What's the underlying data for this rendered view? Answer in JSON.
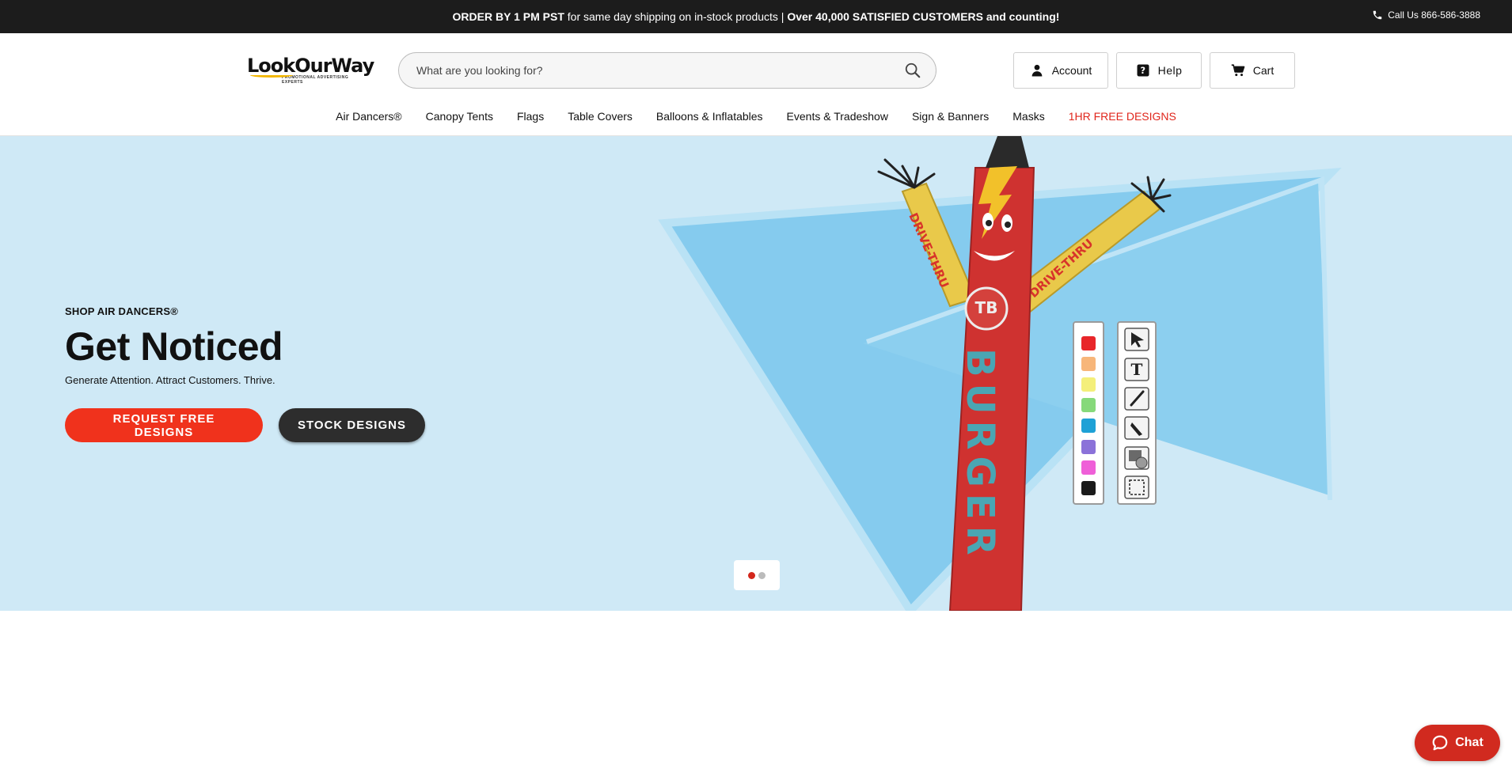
{
  "topbar": {
    "promo_bold_1": "ORDER BY 1 PM PST",
    "promo_text": " for same day shipping on in-stock products | ",
    "promo_bold_2": "Over 40,000 SATISFIED CUSTOMERS and counting!",
    "call_label": "Call Us 866-586-3888"
  },
  "logo": {
    "wordmark": "LookOurWay",
    "tagline": "PROMOTIONAL ADVERTISING EXPERTS"
  },
  "search": {
    "placeholder": "What are you looking for?"
  },
  "header_buttons": {
    "account": "Account",
    "help": "Help",
    "cart": "Cart"
  },
  "nav": {
    "items": [
      {
        "label": "Air Dancers®"
      },
      {
        "label": "Canopy Tents"
      },
      {
        "label": "Flags"
      },
      {
        "label": "Table Covers"
      },
      {
        "label": "Balloons & Inflatables"
      },
      {
        "label": "Events & Tradeshow"
      },
      {
        "label": "Sign & Banners"
      },
      {
        "label": "Masks"
      },
      {
        "label": "1HR FREE DESIGNS"
      }
    ]
  },
  "hero": {
    "kicker": "SHOP AIR DANCERS®",
    "title": "Get Noticed",
    "subtitle": "Generate Attention. Attract Customers. Thrive.",
    "cta_primary": "REQUEST FREE DESIGNS",
    "cta_secondary": "STOCK DESIGNS",
    "dancer_arm_text": "DRIVE-THRU",
    "dancer_body_text": "BURGER",
    "dancer_badge": "TB",
    "slides_total": 2,
    "active_slide": 1,
    "palette_colors": [
      "#e8262a",
      "#f7b67a",
      "#f4ef7a",
      "#86d97a",
      "#1ea1d6",
      "#8b72d9",
      "#ef5fd8",
      "#1a1a1a"
    ],
    "tool_icons": [
      "pointer-tool-icon",
      "text-tool-icon",
      "brush-tool-icon",
      "pen-tool-icon",
      "shape-tool-icon",
      "select-tool-icon"
    ]
  },
  "colors": {
    "accent_red": "#f0321c",
    "hero_bg": "#cfe9f6",
    "topbar_bg": "#1c1c1c"
  },
  "chat": {
    "label": "Chat"
  }
}
